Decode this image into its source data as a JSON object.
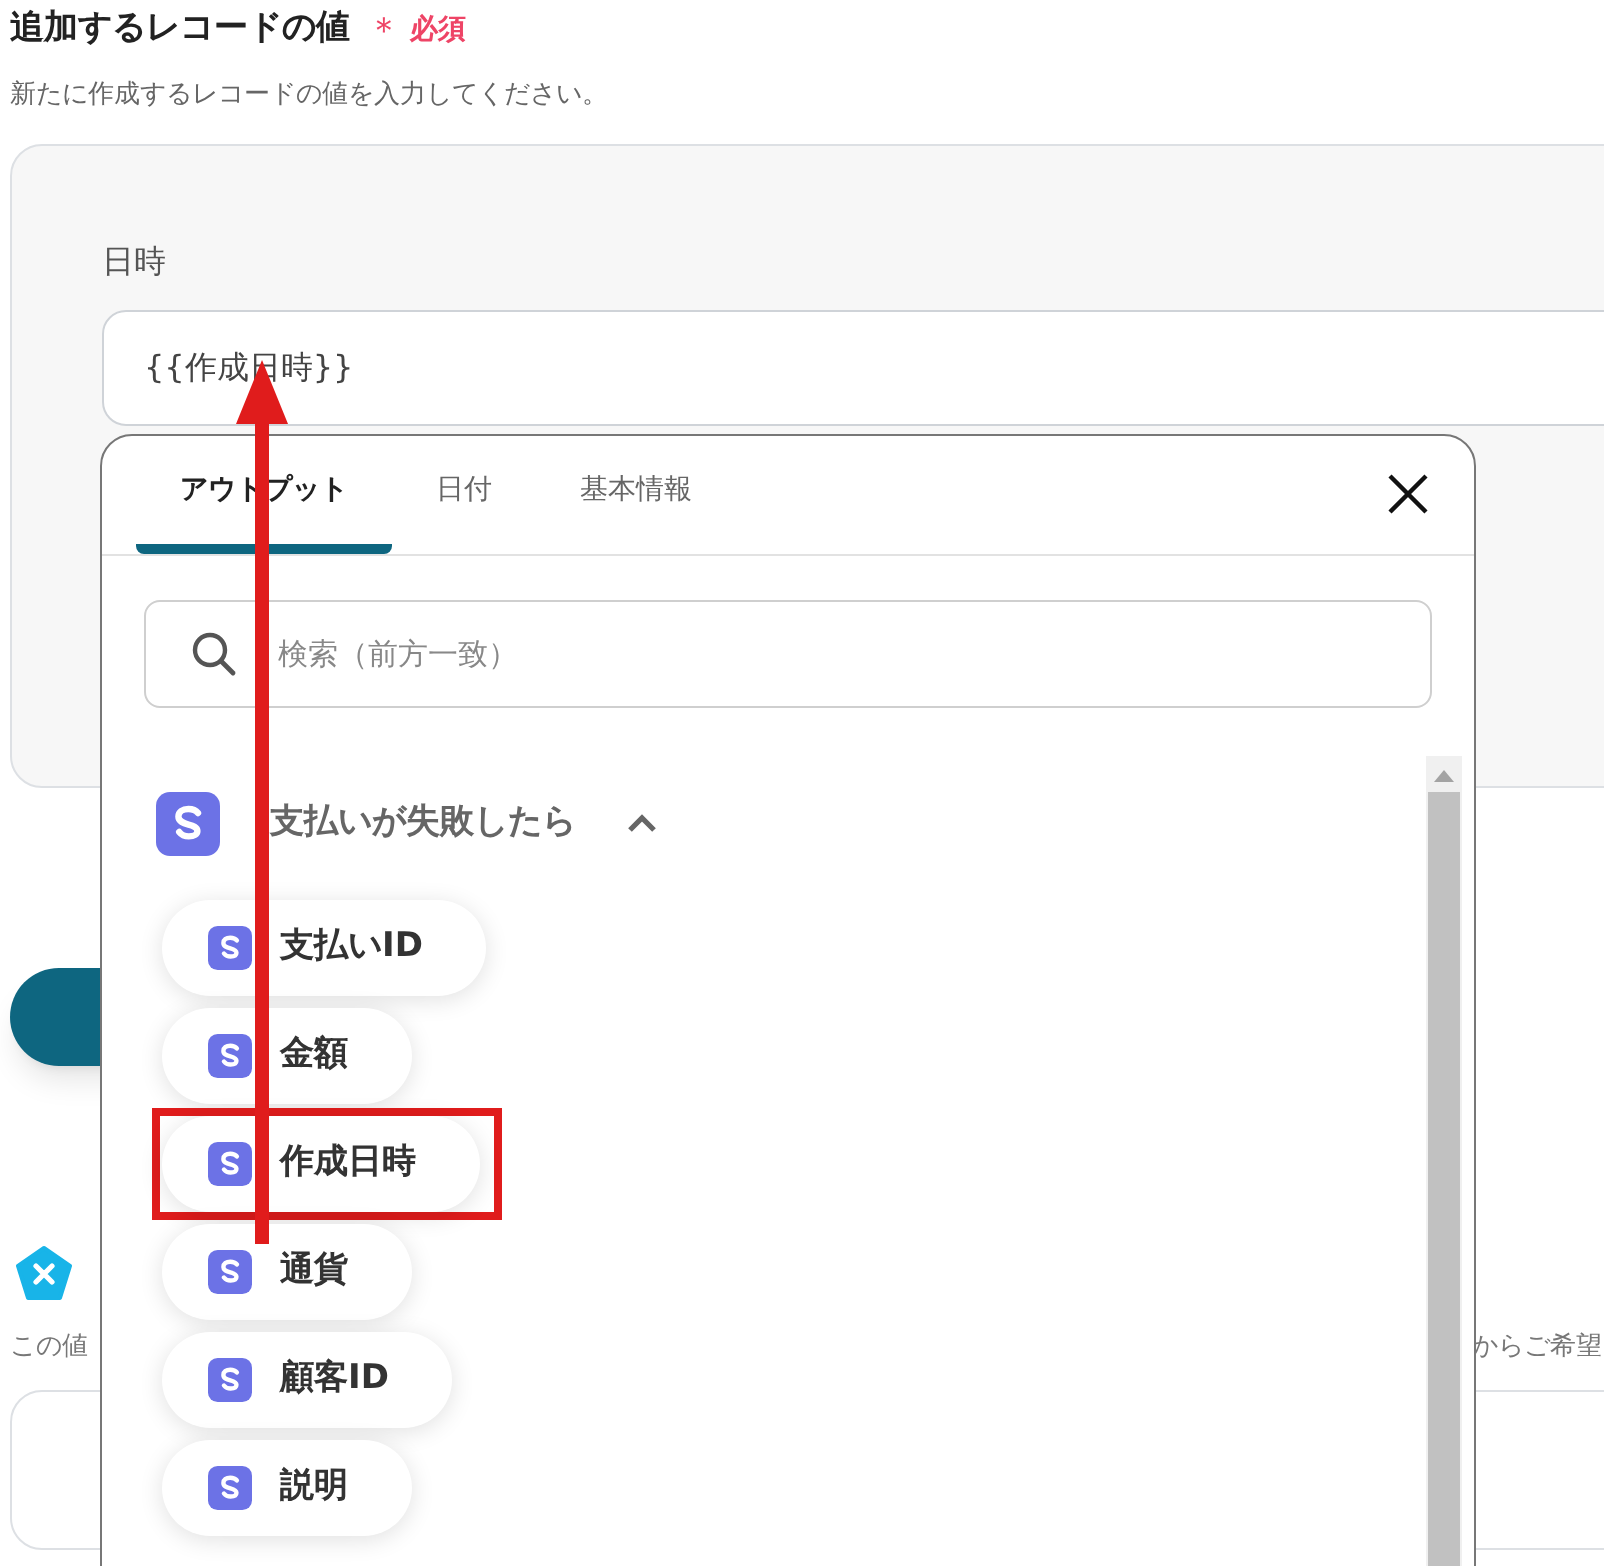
{
  "section": {
    "title": "追加するレコードの値",
    "required_mark": "＊",
    "required_label": "必須",
    "description": "新たに作成するレコードの値を入力してください。"
  },
  "field": {
    "label": "日時",
    "value": "{{作成日時}}"
  },
  "popup": {
    "tabs": [
      {
        "label": "アウトプット",
        "selected": true
      },
      {
        "label": "日付",
        "selected": false
      },
      {
        "label": "基本情報",
        "selected": false
      }
    ],
    "search": {
      "placeholder": "検索（前方一致）"
    },
    "group": {
      "title": "支払いが失敗したら",
      "expanded": true,
      "items": [
        {
          "label": "支払いID",
          "highlighted": false
        },
        {
          "label": "金額",
          "highlighted": false
        },
        {
          "label": "作成日時",
          "highlighted": true
        },
        {
          "label": "通貨",
          "highlighted": false
        },
        {
          "label": "顧客ID",
          "highlighted": false
        },
        {
          "label": "説明",
          "highlighted": false
        }
      ]
    }
  },
  "background": {
    "note_start": "この値",
    "note_end": "からご希望"
  }
}
